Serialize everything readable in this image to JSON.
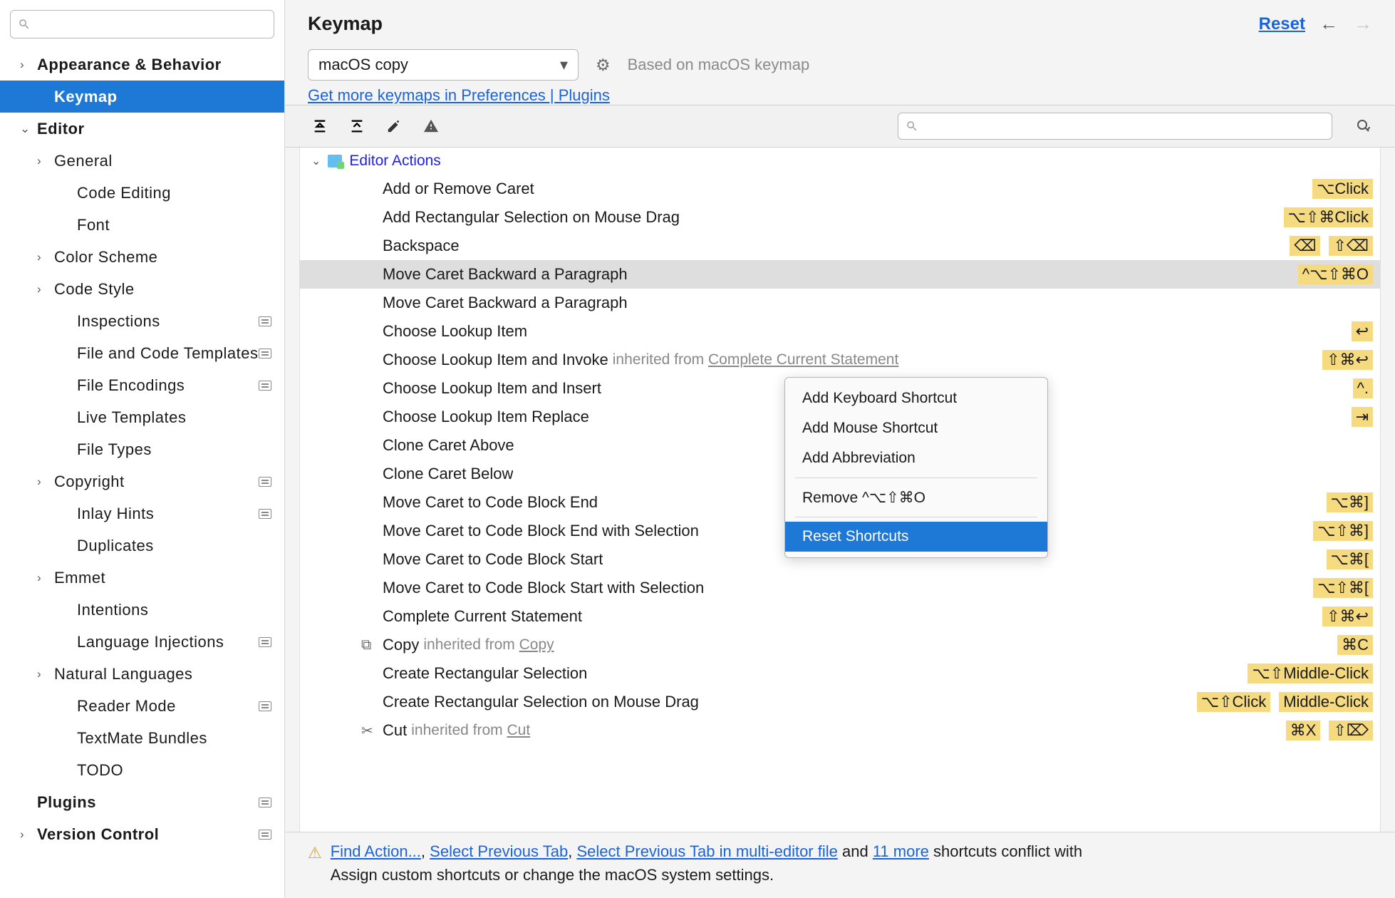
{
  "sidebar": {
    "search_placeholder": "",
    "nodes": [
      {
        "label": "Appearance & Behavior",
        "bold": true,
        "chev": "›",
        "lvl": 0
      },
      {
        "label": "Keymap",
        "bold": true,
        "lvl": 1,
        "selected": true
      },
      {
        "label": "Editor",
        "bold": true,
        "chev": "⌄",
        "lvl": 0
      },
      {
        "label": "General",
        "chev": "›",
        "lvl": 1
      },
      {
        "label": "Code Editing",
        "lvl": 2
      },
      {
        "label": "Font",
        "lvl": 2
      },
      {
        "label": "Color Scheme",
        "chev": "›",
        "lvl": 1
      },
      {
        "label": "Code Style",
        "chev": "›",
        "lvl": 1
      },
      {
        "label": "Inspections",
        "lvl": 2,
        "tag": true
      },
      {
        "label": "File and Code Templates",
        "lvl": 2,
        "tag": true
      },
      {
        "label": "File Encodings",
        "lvl": 2,
        "tag": true
      },
      {
        "label": "Live Templates",
        "lvl": 2
      },
      {
        "label": "File Types",
        "lvl": 2
      },
      {
        "label": "Copyright",
        "chev": "›",
        "lvl": 1,
        "tag": true
      },
      {
        "label": "Inlay Hints",
        "lvl": 2,
        "tag": true
      },
      {
        "label": "Duplicates",
        "lvl": 2
      },
      {
        "label": "Emmet",
        "chev": "›",
        "lvl": 1
      },
      {
        "label": "Intentions",
        "lvl": 2
      },
      {
        "label": "Language Injections",
        "lvl": 2,
        "tag": true
      },
      {
        "label": "Natural Languages",
        "chev": "›",
        "lvl": 1
      },
      {
        "label": "Reader Mode",
        "lvl": 2,
        "tag": true
      },
      {
        "label": "TextMate Bundles",
        "lvl": 2
      },
      {
        "label": "TODO",
        "lvl": 2
      },
      {
        "label": "Plugins",
        "bold": true,
        "lvl": 0,
        "tag": true
      },
      {
        "label": "Version Control",
        "bold": true,
        "chev": "›",
        "lvl": 0,
        "tag": true
      }
    ]
  },
  "header": {
    "title": "Keymap",
    "reset": "Reset"
  },
  "keymap": {
    "selected": "macOS copy",
    "based": "Based on macOS keymap",
    "get_more": "Get more keymaps in Preferences | Plugins"
  },
  "group": {
    "title": "Editor Actions"
  },
  "actions": [
    {
      "label": "Add or Remove Caret",
      "sc": [
        "⌥Click"
      ]
    },
    {
      "label": "Add Rectangular Selection on Mouse Drag",
      "sc": [
        "⌥⇧⌘Click"
      ]
    },
    {
      "label": "Backspace",
      "sc": [
        "⌫",
        "⇧⌫"
      ]
    },
    {
      "label": "Move Caret Backward a Paragraph",
      "sc": [
        "^⌥⇧⌘O"
      ],
      "selected": true
    },
    {
      "label": "Move Caret Backward a Paragraph"
    },
    {
      "label": "Choose Lookup Item",
      "sc": [
        "↩"
      ]
    },
    {
      "label": "Choose Lookup Item and Invoke",
      "inherit": "Complete Current Statement",
      "sc": [
        "⇧⌘↩"
      ]
    },
    {
      "label": "Choose Lookup Item and Insert",
      "sc": [
        "^."
      ]
    },
    {
      "label": "Choose Lookup Item Replace",
      "sc": [
        "⇥"
      ]
    },
    {
      "label": "Clone Caret Above"
    },
    {
      "label": "Clone Caret Below"
    },
    {
      "label": "Move Caret to Code Block End",
      "sc": [
        "⌥⌘]"
      ]
    },
    {
      "label": "Move Caret to Code Block End with Selection",
      "sc": [
        "⌥⇧⌘]"
      ]
    },
    {
      "label": "Move Caret to Code Block Start",
      "sc": [
        "⌥⌘["
      ]
    },
    {
      "label": "Move Caret to Code Block Start with Selection",
      "sc": [
        "⌥⇧⌘["
      ]
    },
    {
      "label": "Complete Current Statement",
      "sc": [
        "⇧⌘↩"
      ]
    },
    {
      "label": "Copy",
      "inherit": "Copy",
      "icon": "copy",
      "sc": [
        "⌘C"
      ]
    },
    {
      "label": "Create Rectangular Selection",
      "sc": [
        "⌥⇧Middle-Click"
      ]
    },
    {
      "label": "Create Rectangular Selection on Mouse Drag",
      "sc": [
        "⌥⇧Click",
        "Middle-Click"
      ]
    },
    {
      "label": "Cut",
      "inherit": "Cut",
      "icon": "cut",
      "sc": [
        "⌘X",
        "⇧⌦"
      ]
    }
  ],
  "context": {
    "items": [
      {
        "label": "Add Keyboard Shortcut"
      },
      {
        "label": "Add Mouse Shortcut"
      },
      {
        "label": "Add Abbreviation"
      },
      {
        "sep": true
      },
      {
        "label": "Remove ^⌥⇧⌘O"
      },
      {
        "sep": true
      },
      {
        "label": "Reset Shortcuts",
        "hl": true
      }
    ]
  },
  "footer": {
    "links": [
      "Find Action...",
      "Select Previous Tab",
      "Select Previous Tab in multi-editor file",
      "11 more"
    ],
    "mid": " and ",
    "tail": " shortcuts conflict with",
    "line2": "Assign custom shortcuts or change the macOS system settings."
  }
}
